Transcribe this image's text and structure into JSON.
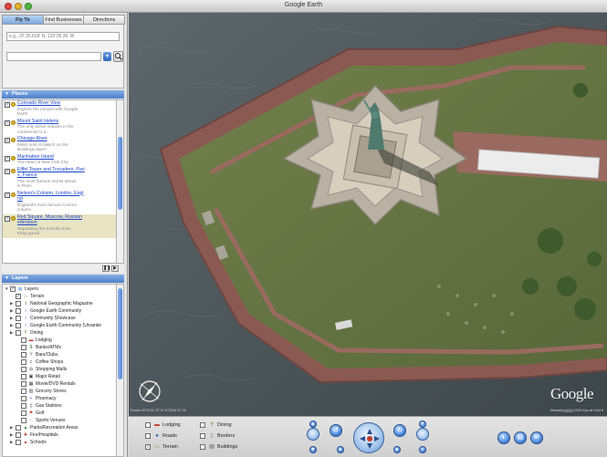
{
  "window": {
    "title": "Google Earth"
  },
  "tabs": [
    "Fly To",
    "Find Businesses",
    "Directions"
  ],
  "search": {
    "placeholder": "e.g., 37 25.818' N, 122 05.36' W"
  },
  "places": {
    "header": "Places",
    "items": [
      {
        "title": "Colorado River View",
        "desc": [
          "Explore the canyon with Google",
          "Earth"
        ]
      },
      {
        "title": "Mount Saint Helens",
        "desc": [
          "The only active volcano in the",
          "continental U.S."
        ]
      },
      {
        "title": "Chicago River",
        "desc": [
          "Make sure to switch on the",
          "Buildings layer!"
        ]
      },
      {
        "title": "Manhattan Island",
        "desc": [
          "The heart of New York City"
        ]
      },
      {
        "title": "Eiffel Tower and Trocadero, Pari",
        "title2": "s, France",
        "desc": [
          "The most famous tourist attract",
          "in Paris"
        ]
      },
      {
        "title": "Nelson's Column, London, Engl",
        "title2": "nd",
        "desc": [
          "England's most famous Commi",
          "column"
        ]
      },
      {
        "title": "Red Square, Moscow, Russian",
        "title2": "ederation",
        "desc": [
          "Separating the Kremlin from",
          "Kitay-gorod"
        ]
      }
    ]
  },
  "layers": {
    "header": "Layers",
    "items": [
      {
        "label": "Layers",
        "indent": 0,
        "tri": "▼",
        "checked": true,
        "icon": "globe-icon",
        "sym": "◍",
        "color": "#2d6fd1"
      },
      {
        "label": "Terrain",
        "indent": 1,
        "tri": "",
        "checked": true,
        "icon": "terrain-icon",
        "sym": "▭",
        "color": "#6a9a4a"
      },
      {
        "label": "National Geographic Magazine",
        "indent": 1,
        "tri": "▶",
        "checked": false,
        "icon": "info-icon",
        "sym": "i",
        "color": "#222"
      },
      {
        "label": "Google Earth Community",
        "indent": 1,
        "tri": "▶",
        "checked": false,
        "icon": "info-icon",
        "sym": "i",
        "color": "#3a6fd0"
      },
      {
        "label": "Community Showcase",
        "indent": 1,
        "tri": "▶",
        "checked": false,
        "icon": "info-icon",
        "sym": "i",
        "color": "#3a6fd0"
      },
      {
        "label": "Google Earth Community (Unranke",
        "indent": 1,
        "tri": "▶",
        "checked": false,
        "icon": "info-icon",
        "sym": "i",
        "color": "#3a6fd0"
      },
      {
        "label": "Dining",
        "indent": 1,
        "tri": "▶",
        "checked": false,
        "icon": "dining-icon",
        "sym": "Y",
        "color": "#8a5a20"
      },
      {
        "label": "Lodging",
        "indent": 2,
        "tri": "",
        "checked": false,
        "icon": "lodging-icon",
        "sym": "▬",
        "color": "#c0392b"
      },
      {
        "label": "Banks/ATMs",
        "indent": 2,
        "tri": "",
        "checked": false,
        "icon": "bank-icon",
        "sym": "$",
        "color": "#2e7d32"
      },
      {
        "label": "Bars/Clubs",
        "indent": 2,
        "tri": "",
        "checked": false,
        "icon": "bar-icon",
        "sym": "Y",
        "color": "#666"
      },
      {
        "label": "Coffee Shops",
        "indent": 2,
        "tri": "",
        "checked": false,
        "icon": "coffee-icon",
        "sym": "c",
        "color": "#6d4c2f"
      },
      {
        "label": "Shopping Malls",
        "indent": 2,
        "tri": "",
        "checked": false,
        "icon": "shopping-icon",
        "sym": "◘",
        "color": "#444"
      },
      {
        "label": "Major Retail",
        "indent": 2,
        "tri": "",
        "checked": false,
        "icon": "retail-icon",
        "sym": "▣",
        "color": "#444"
      },
      {
        "label": "Movie/DVD Rentals",
        "indent": 2,
        "tri": "",
        "checked": false,
        "icon": "movie-icon",
        "sym": "▦",
        "color": "#444"
      },
      {
        "label": "Grocery Stores",
        "indent": 2,
        "tri": "",
        "checked": false,
        "icon": "grocery-icon",
        "sym": "▥",
        "color": "#444"
      },
      {
        "label": "Pharmacy",
        "indent": 2,
        "tri": "",
        "checked": false,
        "icon": "pharmacy-icon",
        "sym": "+",
        "color": "#2a62b8"
      },
      {
        "label": "Gas Stations",
        "indent": 2,
        "tri": "",
        "checked": false,
        "icon": "gas-icon",
        "sym": "▯",
        "color": "#444"
      },
      {
        "label": "Golf",
        "indent": 2,
        "tri": "",
        "checked": false,
        "icon": "golf-icon",
        "sym": "⚑",
        "color": "#c0392b"
      },
      {
        "label": "Sports Venues",
        "indent": 2,
        "tri": "",
        "checked": false,
        "icon": "sports-icon",
        "sym": "◌",
        "color": "#444"
      },
      {
        "label": "Parks/Recreation Areas",
        "indent": 1,
        "tri": "▶",
        "checked": false,
        "icon": "park-icon",
        "sym": "▲",
        "color": "#2e7d32"
      },
      {
        "label": "Fire/Hospitals",
        "indent": 1,
        "tri": "▶",
        "checked": false,
        "icon": "hospital-icon",
        "sym": "✚",
        "color": "#c0392b"
      },
      {
        "label": "Schools",
        "indent": 1,
        "tri": "▶",
        "checked": false,
        "icon": "school-icon",
        "sym": "▲",
        "color": "#c0392b"
      }
    ]
  },
  "bottom_layers": [
    {
      "label": "Lodging",
      "checked": false,
      "icon": "lodging-icon",
      "sym": "▬",
      "color": "#c0392b"
    },
    {
      "label": "Dining",
      "checked": false,
      "icon": "dining-icon",
      "sym": "Y",
      "color": "#8a5a20"
    },
    {
      "label": "Roads",
      "checked": false,
      "icon": "roads-icon",
      "sym": "●",
      "color": "#2a62b8"
    },
    {
      "label": "Borders",
      "checked": false,
      "icon": "borders-icon",
      "sym": "▯",
      "color": "#777"
    },
    {
      "label": "Terrain",
      "checked": true,
      "icon": "terrain-icon",
      "sym": "▭",
      "color": "#6a9a4a"
    },
    {
      "label": "Buildings",
      "checked": false,
      "icon": "buildings-icon",
      "sym": "▤",
      "color": "#555"
    }
  ],
  "map": {
    "logo": "Google",
    "credit_left": "Pointer 40°41'21.72\" N  74°02'40.31\" W",
    "credit_right": "Streaming ||||||||| 100%  Eye alt 1444 ft"
  }
}
